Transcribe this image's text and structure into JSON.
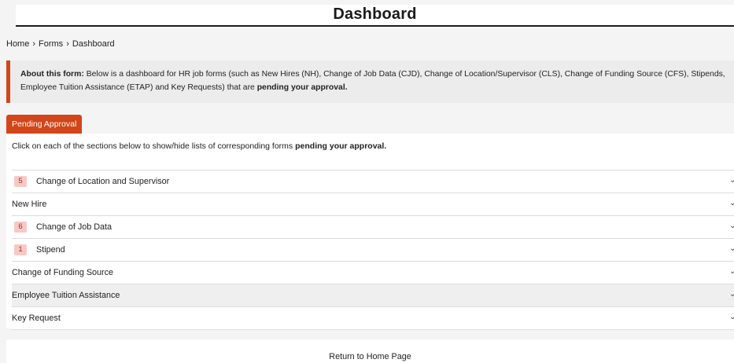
{
  "header": {
    "title": "Dashboard"
  },
  "breadcrumb": {
    "home": "Home",
    "forms": "Forms",
    "current": "Dashboard",
    "separator": "›"
  },
  "notice": {
    "label": "About this form:",
    "text": " Below is a dashboard for HR job forms (such as New Hires (NH), Change of Job Data (CJD), Change of Location/Supervisor (CLS), Change of Funding Source (CFS), Stipends, Employee Tuition Assistance (ETAP) and Key Requests) that are ",
    "emphasis": "pending your approval."
  },
  "tab": {
    "label": "Pending Approval"
  },
  "instructions": {
    "text": "Click on each of the sections below to show/hide lists of corresponding forms ",
    "emphasis": "pending your approval."
  },
  "sections": [
    {
      "count": "5",
      "label": "Change of Location and Supervisor"
    },
    {
      "count": "",
      "label": "New Hire"
    },
    {
      "count": "6",
      "label": "Change of Job Data"
    },
    {
      "count": "1",
      "label": "Stipend"
    },
    {
      "count": "",
      "label": "Change of Funding Source"
    },
    {
      "count": "",
      "label": "Employee Tuition Assistance"
    },
    {
      "count": "",
      "label": "Key Request"
    }
  ],
  "footer": {
    "link": "Return to Home Page"
  },
  "colors": {
    "accent": "#d2461a",
    "badge_bg": "#f7c9c6",
    "badge_text": "#b3261e"
  },
  "icons": {
    "section_toggle": "chevron-down-icon"
  }
}
